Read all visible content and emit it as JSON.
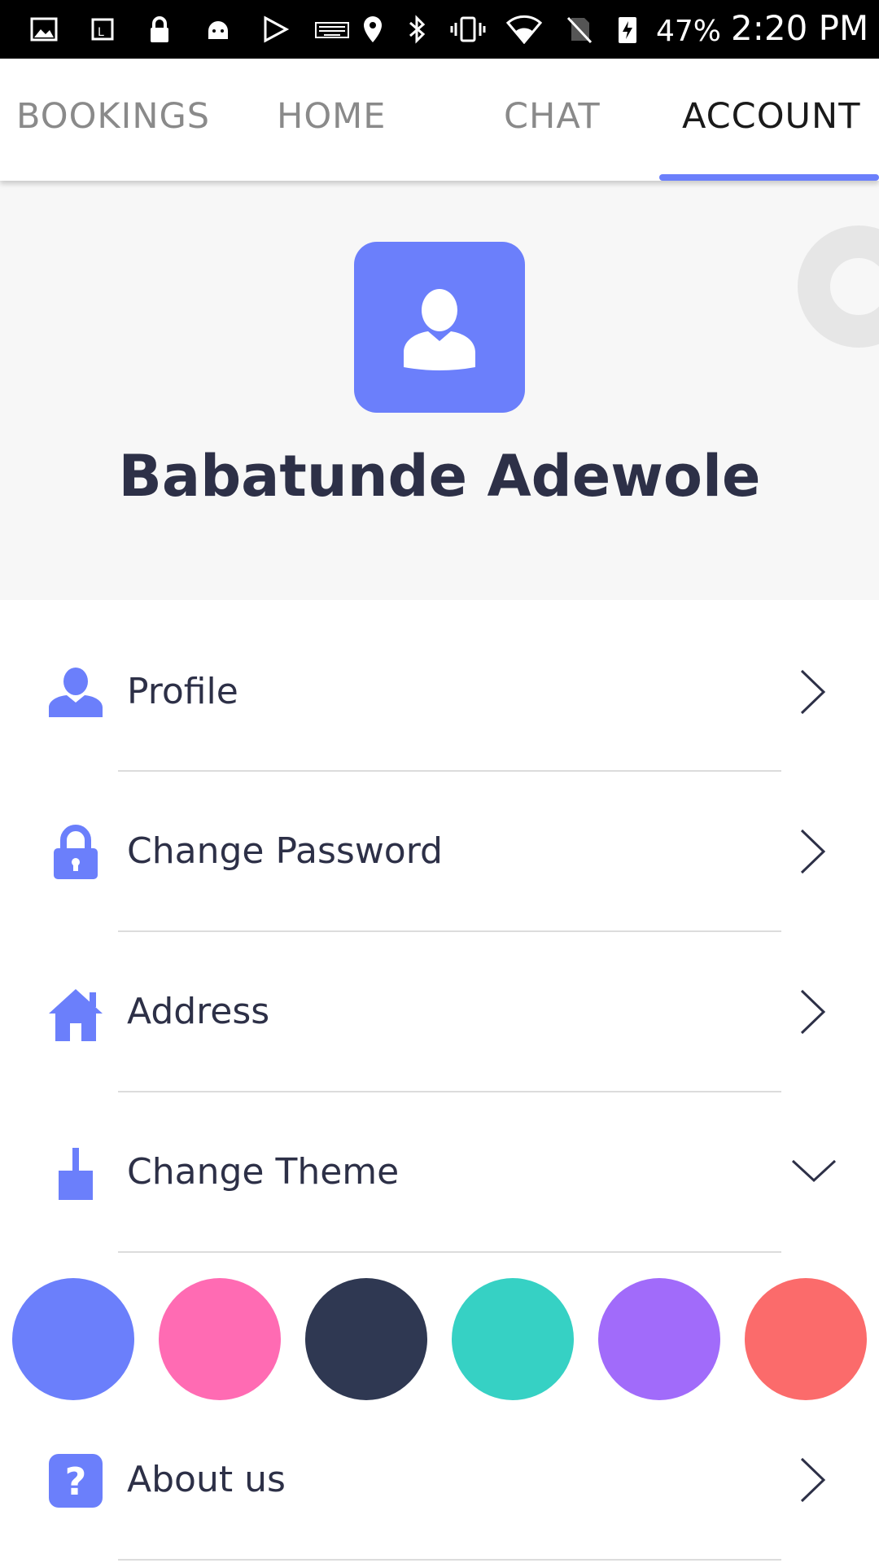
{
  "status_bar": {
    "battery": "47%",
    "time": "2:20 PM"
  },
  "tabs": [
    {
      "label": "BOOKINGS",
      "active": false
    },
    {
      "label": "HOME",
      "active": false
    },
    {
      "label": "CHAT",
      "active": false
    },
    {
      "label": "ACCOUNT",
      "active": true
    }
  ],
  "profile": {
    "name": "Babatunde Adewole"
  },
  "menu": [
    {
      "label": "Profile",
      "icon": "person-icon",
      "indicator": "chevron-right-icon"
    },
    {
      "label": "Change Password",
      "icon": "lock-icon",
      "indicator": "chevron-right-icon"
    },
    {
      "label": "Address",
      "icon": "home-icon",
      "indicator": "chevron-right-icon"
    },
    {
      "label": "Change Theme",
      "icon": "paint-brush-icon",
      "indicator": "chevron-down-icon"
    },
    {
      "label": "About us",
      "icon": "help-icon",
      "indicator": "chevron-right-icon"
    }
  ],
  "theme_colors": [
    "#6b7ffb",
    "#ff6bb3",
    "#2f3852",
    "#36d1c4",
    "#a16bfa",
    "#fb6b6b"
  ],
  "accent_color": "#6b7ffb"
}
